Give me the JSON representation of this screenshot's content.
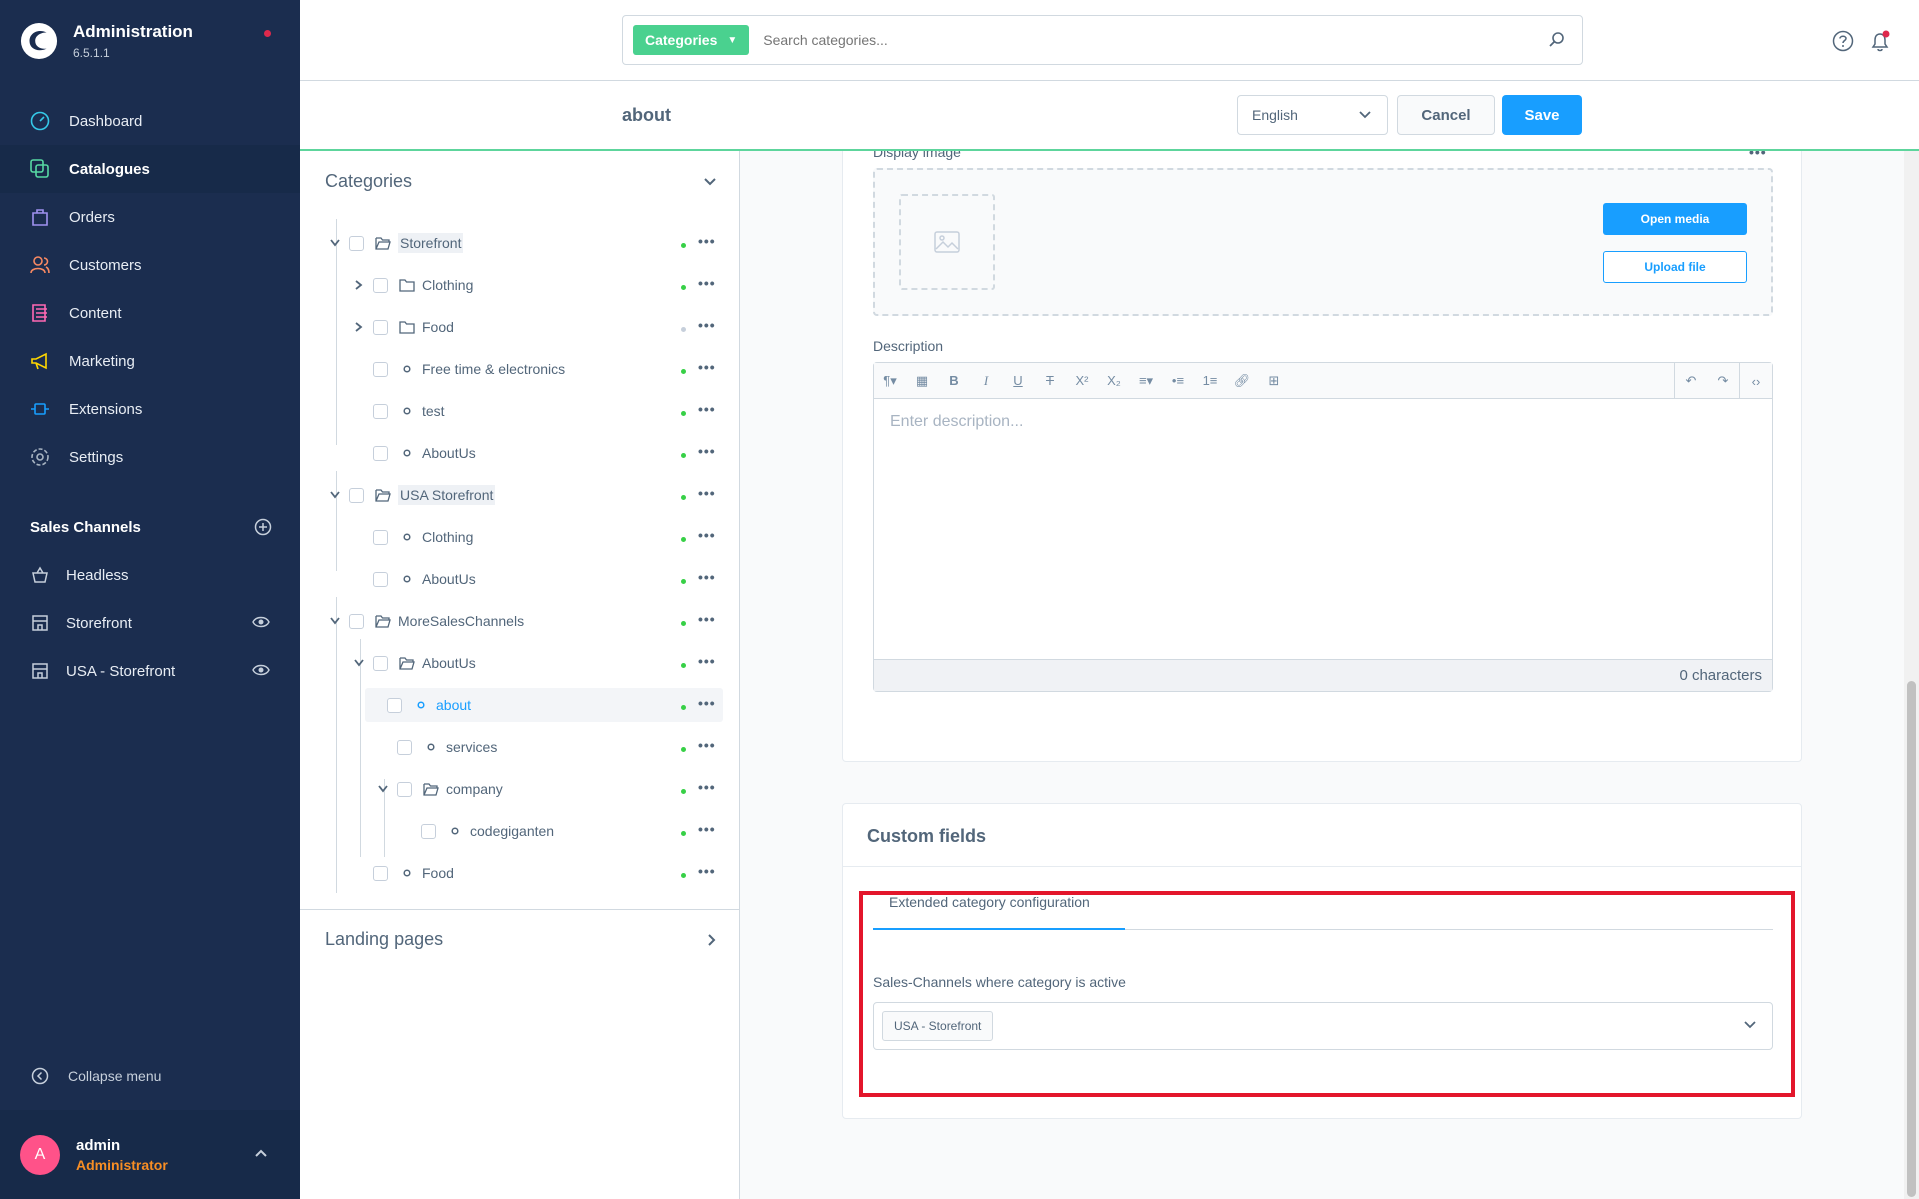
{
  "brand": {
    "title": "Administration",
    "version": "6.5.1.1"
  },
  "nav": [
    {
      "label": "Dashboard",
      "icon": "dashboard-icon"
    },
    {
      "label": "Catalogues",
      "icon": "catalogue-icon",
      "active": true
    },
    {
      "label": "Orders",
      "icon": "orders-icon"
    },
    {
      "label": "Customers",
      "icon": "customers-icon"
    },
    {
      "label": "Content",
      "icon": "content-icon"
    },
    {
      "label": "Marketing",
      "icon": "marketing-icon"
    },
    {
      "label": "Extensions",
      "icon": "extensions-icon"
    },
    {
      "label": "Settings",
      "icon": "settings-icon"
    }
  ],
  "sales_channels": {
    "title": "Sales Channels",
    "items": [
      {
        "label": "Headless"
      },
      {
        "label": "Storefront"
      },
      {
        "label": "USA - Storefront"
      }
    ]
  },
  "collapse_label": "Collapse menu",
  "user": {
    "initial": "A",
    "name": "admin",
    "role": "Administrator"
  },
  "search": {
    "tag": "Categories",
    "placeholder": "Search categories..."
  },
  "smartbar": {
    "title": "about",
    "language": "English",
    "cancel": "Cancel",
    "save": "Save"
  },
  "tree": {
    "title": "Categories",
    "rows": [
      {
        "label": "Storefront"
      },
      {
        "label": "Clothing"
      },
      {
        "label": "Food"
      },
      {
        "label": "Free time & electronics"
      },
      {
        "label": "test"
      },
      {
        "label": "AboutUs"
      },
      {
        "label": "USA Storefront"
      },
      {
        "label": "Clothing"
      },
      {
        "label": "AboutUs"
      },
      {
        "label": "MoreSalesChannels"
      },
      {
        "label": "AboutUs"
      },
      {
        "label": "about"
      },
      {
        "label": "services"
      },
      {
        "label": "company"
      },
      {
        "label": "codegiganten"
      },
      {
        "label": "Food"
      }
    ],
    "landing_pages": "Landing pages"
  },
  "media": {
    "label": "Display image",
    "open": "Open media",
    "upload": "Upload file"
  },
  "description": {
    "label": "Description",
    "placeholder": "Enter description...",
    "counter": "0 characters"
  },
  "custom_fields": {
    "title": "Custom fields",
    "tab": "Extended category configuration",
    "field_label": "Sales-Channels where category is active",
    "selected": "USA - Storefront"
  },
  "colors": {
    "sidebar": "#1b2d4f",
    "accent": "#189eff",
    "success": "#37d046",
    "highlight": "#e3162b",
    "tag": "#4ad18f"
  }
}
